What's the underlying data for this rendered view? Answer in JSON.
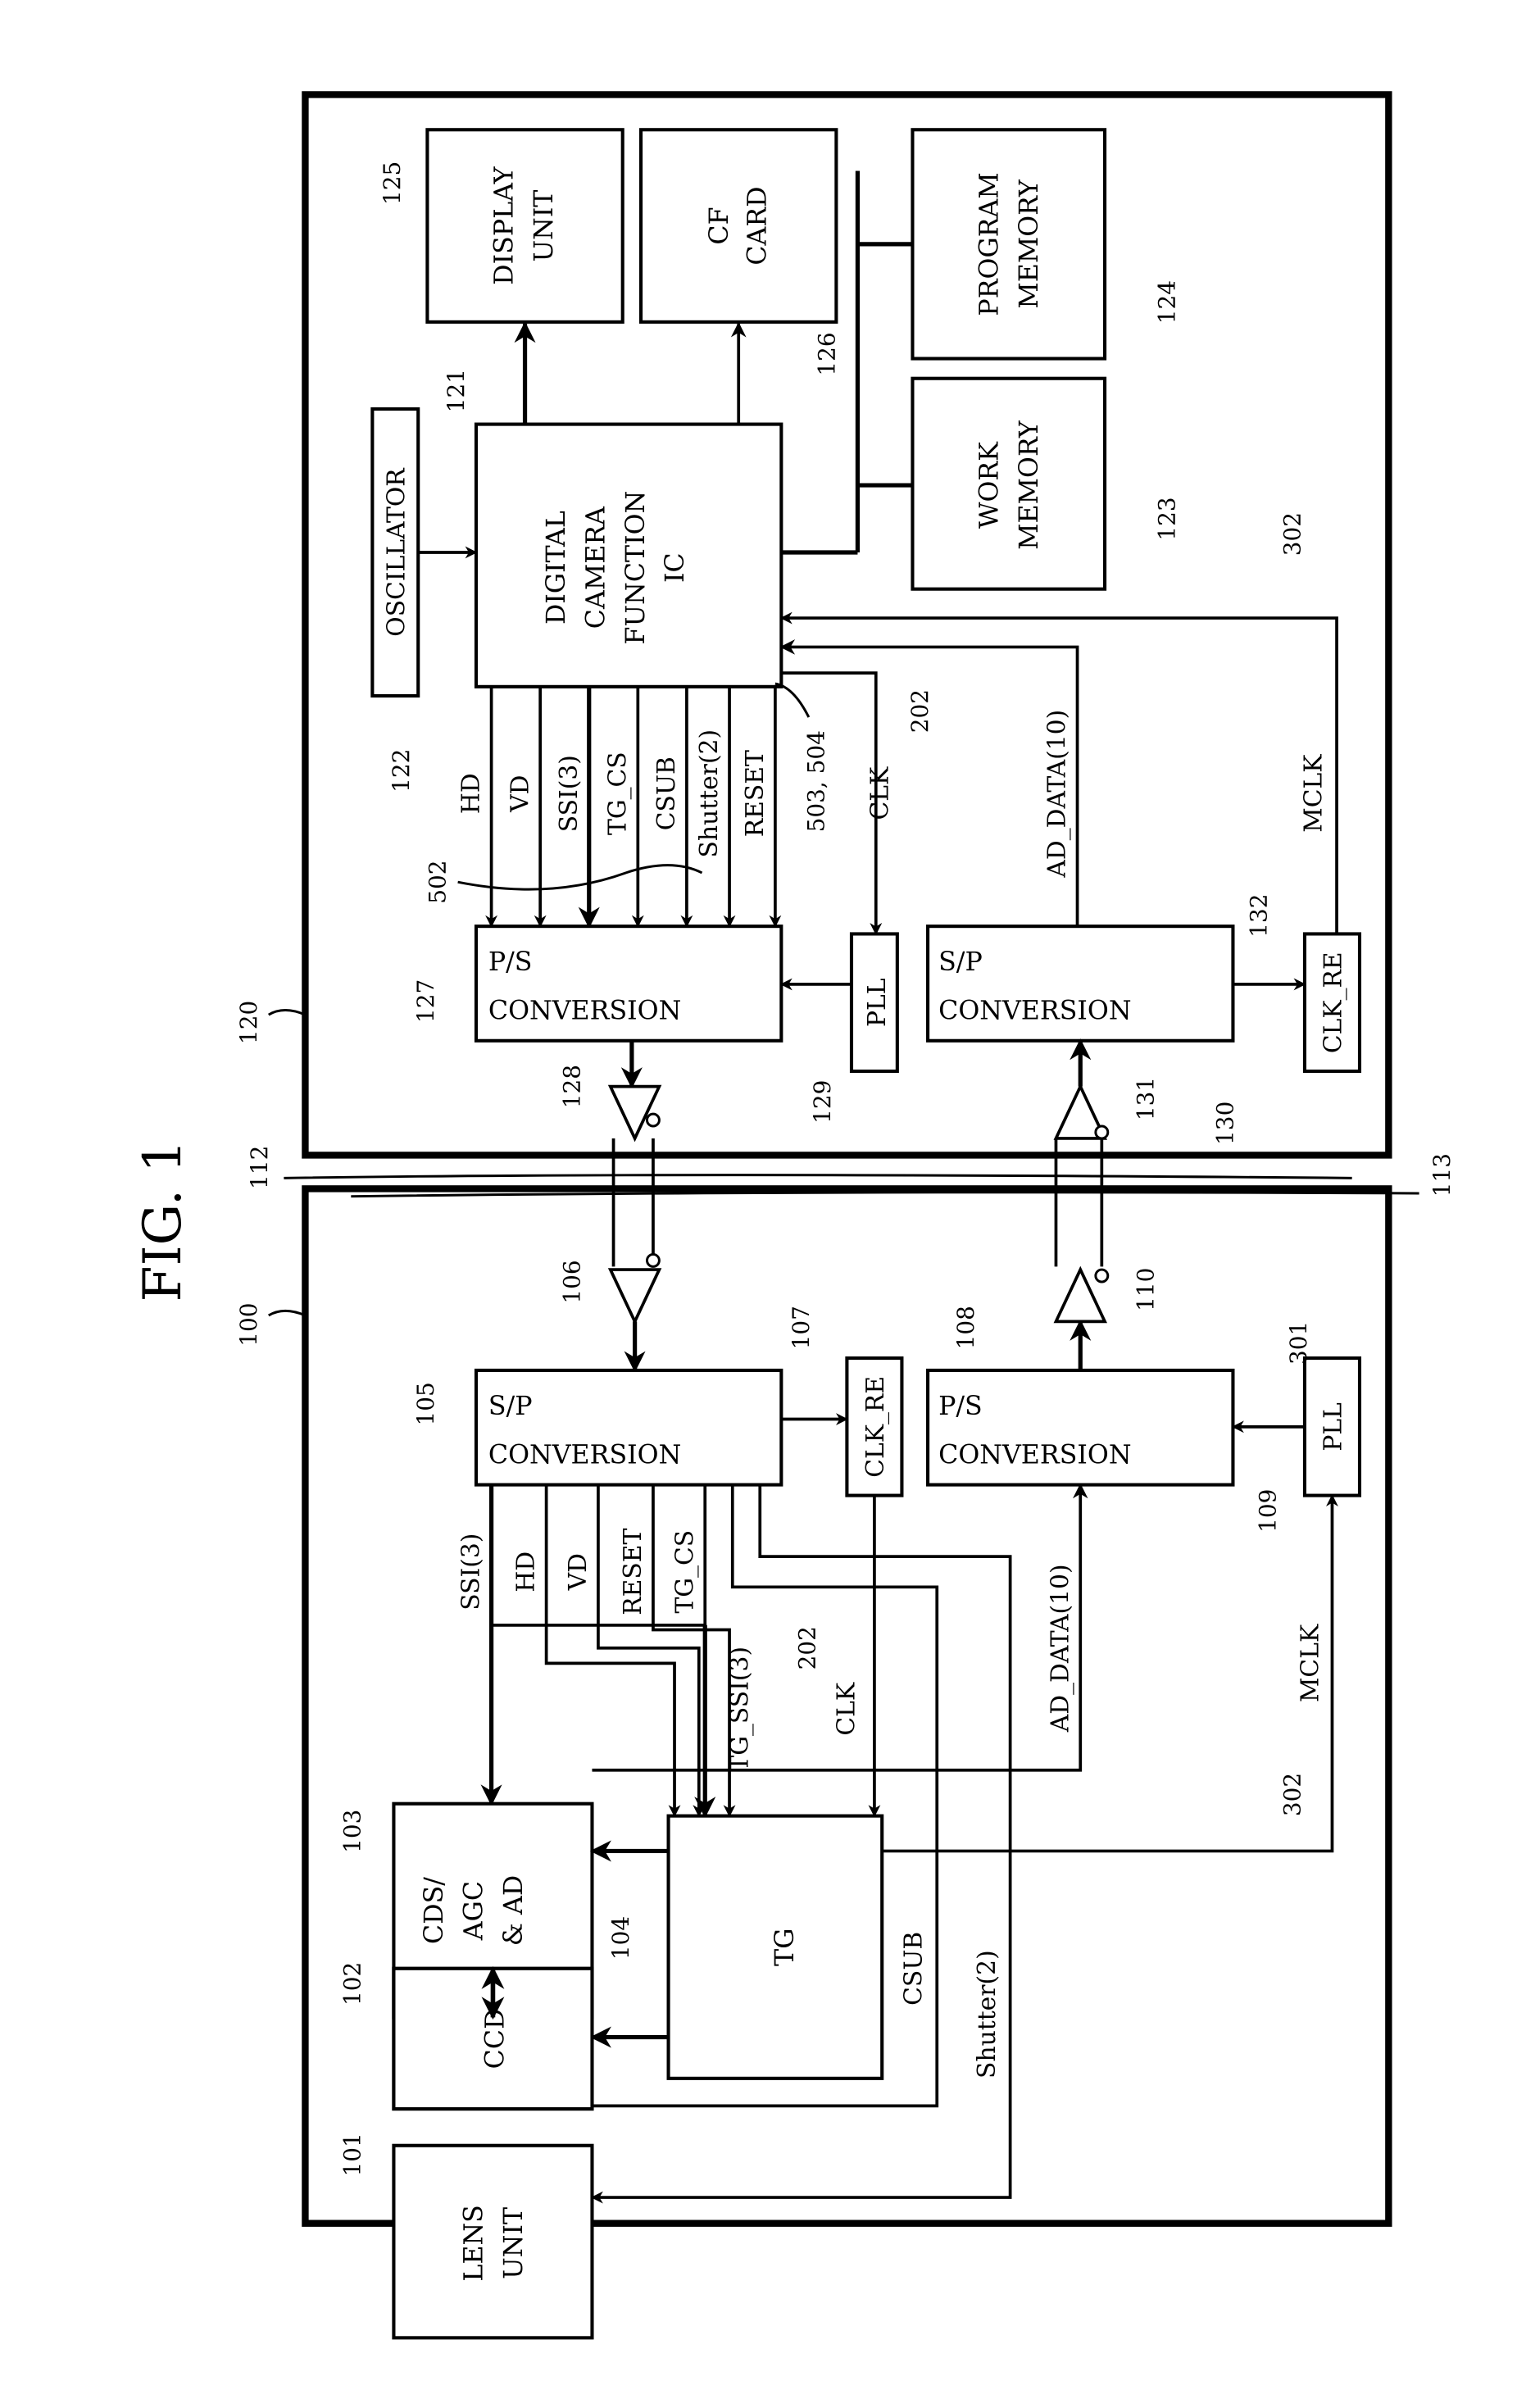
{
  "figure": {
    "title": "FIG. 1"
  },
  "units": {
    "host": {
      "ref": "120"
    },
    "camera_head": {
      "ref": "100"
    }
  },
  "cables": {
    "ref_a": "112",
    "ref_b": "113"
  },
  "host_blocks": {
    "display_unit": {
      "ref": "125",
      "line1": "DISPLAY",
      "line2": "UNIT"
    },
    "cf_card": {
      "ref": "126",
      "line1": "CF",
      "line2": "CARD"
    },
    "program_memory": {
      "ref": "124",
      "line1": "PROGRAM",
      "line2": "MEMORY"
    },
    "work_memory": {
      "ref": "123",
      "line1": "WORK",
      "line2": "MEMORY"
    },
    "oscillator": {
      "ref": "122",
      "label": "OSCILLATOR"
    },
    "camera_ic": {
      "ref": "121",
      "line1": "DIGITAL",
      "line2": "CAMERA",
      "line3": "FUNCTION",
      "line4": "IC"
    },
    "ps_conversion": {
      "ref": "127",
      "line1": "P/S",
      "line2": "CONVERSION"
    },
    "pll": {
      "ref": "129",
      "label": "PLL"
    },
    "sp_conversion": {
      "ref": "130",
      "line1": "S/P",
      "line2": "CONVERSION"
    },
    "clk_re": {
      "ref": "132",
      "label": "CLK_RE"
    },
    "driver": {
      "ref": "128"
    },
    "receiver": {
      "ref": "131"
    }
  },
  "host_signals": {
    "hd": "HD",
    "vd": "VD",
    "ssi": "SSI(3)",
    "tg_cs": "TG_CS",
    "csub": "CSUB",
    "shutter": "Shutter(2)",
    "reset": "RESET",
    "clk": "CLK",
    "ad_data": "AD_DATA(10)",
    "mclk": "MCLK",
    "ref_502": "502",
    "ref_503_504": "503, 504",
    "ref_202": "202",
    "ref_302": "302"
  },
  "head_blocks": {
    "sp_conversion": {
      "ref": "105",
      "line1": "S/P",
      "line2": "CONVERSION"
    },
    "clk_re": {
      "ref": "107",
      "label": "CLK_RE"
    },
    "ps_conversion": {
      "ref": "108",
      "line1": "P/S",
      "line2": "CONVERSION"
    },
    "pll": {
      "ref": "109",
      "label": "PLL"
    },
    "cds_agc_ad": {
      "ref": "103",
      "line1": "CDS/",
      "line2": "AGC",
      "line3": "& AD"
    },
    "tg": {
      "ref": "104",
      "label": "TG"
    },
    "ccd": {
      "ref": "102",
      "label": "CCD"
    },
    "lens_unit": {
      "ref": "101",
      "line1": "LENS",
      "line2": "UNIT"
    },
    "receiver": {
      "ref": "106"
    },
    "driver": {
      "ref": "110"
    }
  },
  "head_signals": {
    "ssi": "SSI(3)",
    "hd": "HD",
    "vd": "VD",
    "reset": "RESET",
    "tg_cs": "TG_CS",
    "tg_ssi": "TG_SSI(3)",
    "clk": "CLK",
    "ad_data": "AD_DATA(10)",
    "mclk": "MCLK",
    "csub": "CSUB",
    "shutter": "Shutter(2)",
    "ref_202": "202",
    "ref_302": "302",
    "ref_301": "301"
  }
}
